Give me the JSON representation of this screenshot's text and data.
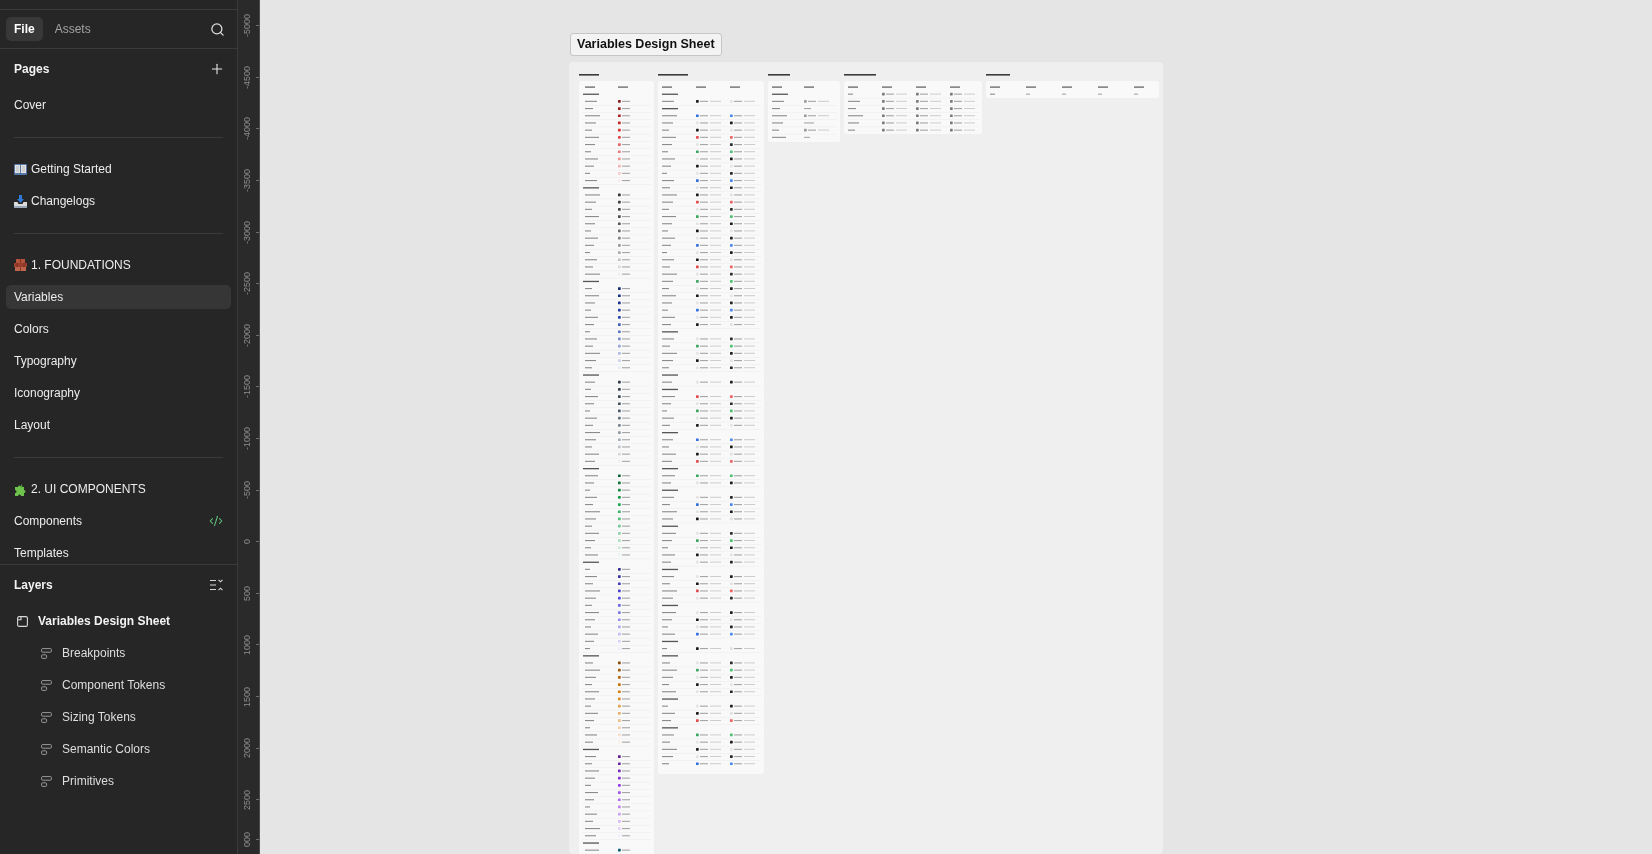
{
  "sidebar": {
    "tabs": [
      {
        "label": "File",
        "selected": true
      },
      {
        "label": "Assets",
        "selected": false
      }
    ],
    "pages": {
      "title": "Pages",
      "groups": [
        {
          "items": [
            {
              "label": "Cover",
              "selected": false,
              "code_linked": false
            }
          ]
        },
        {
          "items": [
            {
              "label": "Getting Started",
              "selected": false,
              "code_linked": false
            },
            {
              "label": "Changelogs",
              "selected": false,
              "code_linked": false
            }
          ]
        },
        {
          "items": [
            {
              "label": "1. FOUNDATIONS",
              "selected": false,
              "code_linked": false
            },
            {
              "label": "Variables",
              "selected": true,
              "code_linked": false
            },
            {
              "label": "Colors",
              "selected": false,
              "code_linked": false
            },
            {
              "label": "Typography",
              "selected": false,
              "code_linked": false
            },
            {
              "label": "Iconography",
              "selected": false,
              "code_linked": false
            },
            {
              "label": "Layout",
              "selected": false,
              "code_linked": false
            }
          ]
        },
        {
          "items": [
            {
              "label": "2. UI COMPONENTS",
              "selected": false,
              "code_linked": false
            },
            {
              "label": "Components",
              "selected": false,
              "code_linked": true
            },
            {
              "label": "Templates",
              "selected": false,
              "code_linked": false
            }
          ]
        }
      ]
    },
    "layers": {
      "title": "Layers",
      "tree": [
        {
          "label": "Variables Design Sheet",
          "kind": "frame",
          "children": [
            {
              "label": "Breakpoints",
              "kind": "stack"
            },
            {
              "label": "Component Tokens",
              "kind": "stack"
            },
            {
              "label": "Sizing Tokens",
              "kind": "stack"
            },
            {
              "label": "Semantic Colors",
              "kind": "stack"
            },
            {
              "label": "Primitives",
              "kind": "stack"
            }
          ]
        }
      ]
    }
  },
  "ruler": {
    "labels": [
      "-5000",
      "-4500",
      "-4000",
      "-3500",
      "-3000",
      "-2500",
      "-2000",
      "-1500",
      "-1000",
      "-500",
      "0",
      "500",
      "1000",
      "1500",
      "2000",
      "2500",
      "000"
    ]
  },
  "canvas": {
    "frame_label": "Variables Design Sheet"
  }
}
